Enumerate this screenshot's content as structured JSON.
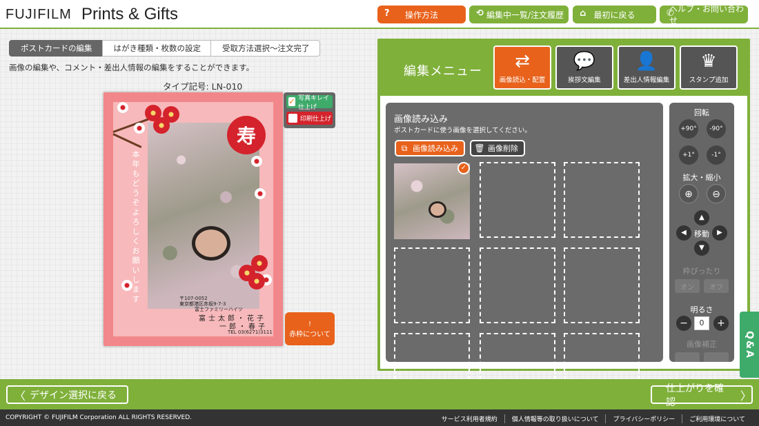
{
  "header": {
    "brand": "FUJIFILM",
    "product": "Prints & Gifts",
    "buttons": [
      {
        "label": "操作方法",
        "icon": "question-icon"
      },
      {
        "label": "編集中一覧/注文履歴",
        "icon": "history-icon"
      },
      {
        "label": "最初に戻る",
        "icon": "home-icon"
      },
      {
        "label": "ヘルプ・お問い合わせ",
        "icon": "phone-icon"
      }
    ]
  },
  "breadcrumb": [
    "ポストカードの編集",
    "はがき種類・枚数の設定",
    "受取方法選択〜注文完了"
  ],
  "instruction": "画像の編集や、コメント・差出人情報の編集をすることができます。",
  "type_code": "タイプ記号: LN-010",
  "postcard": {
    "stamp_char": "寿",
    "message": "本年もどうぞよろしくお願いします",
    "postal": "〒107-0052",
    "address1": "東京都港区赤坂9-7-3",
    "address2": "富士ファミリーハイツ",
    "name1": "富士太郎・花子",
    "name2": "一郎・春子",
    "tel": "TEL 03(6271)3111"
  },
  "finish_options": [
    {
      "label": "写真キレイ仕上げ",
      "checked": true
    },
    {
      "label": "印刷仕上げ",
      "checked": false
    }
  ],
  "red_frame_button": {
    "icon": "!",
    "label": "赤枠について"
  },
  "edit_menu": {
    "title": "編集メニュー",
    "tools": [
      {
        "label": "画像読込・配置",
        "icon": "image-load-icon",
        "active": true
      },
      {
        "label": "挨拶文編集",
        "icon": "speech-bubble-icon",
        "active": false
      },
      {
        "label": "差出人情報編集",
        "icon": "person-icon",
        "active": false
      },
      {
        "label": "スタンプ追加",
        "icon": "stamp-icon",
        "active": false
      }
    ]
  },
  "image_load": {
    "title": "画像読み込み",
    "subtitle": "ポストカードに使う画像を選択してください。",
    "load_button": "画像読み込み",
    "delete_button": "画像削除"
  },
  "controls": {
    "rotate_label": "回転",
    "rotate_buttons": [
      "+90°",
      "-90°",
      "+1°",
      "-1°"
    ],
    "zoom_label": "拡大・縮小",
    "move_label": "移動",
    "fit_label": "枠ぴったり",
    "fit_on": "オン",
    "fit_off": "オフ",
    "brightness_label": "明るさ",
    "brightness_value": "0",
    "correction_label": "画像補正"
  },
  "qa_label": "Q&A",
  "nav": {
    "back": "デザイン選択に戻る",
    "next": "仕上がりを確認"
  },
  "footer": {
    "copyright": "COPYRIGHT © FUJIFILM Corporation ALL RIGHTS RESERVED.",
    "links": [
      "サービス利用者規約",
      "個人情報等の取り扱いについて",
      "プライバシーポリシー",
      "ご利用環境について"
    ]
  },
  "colors": {
    "accent_green": "#7fb03a",
    "accent_orange": "#e8621c",
    "stamp_red": "#d4232c"
  }
}
